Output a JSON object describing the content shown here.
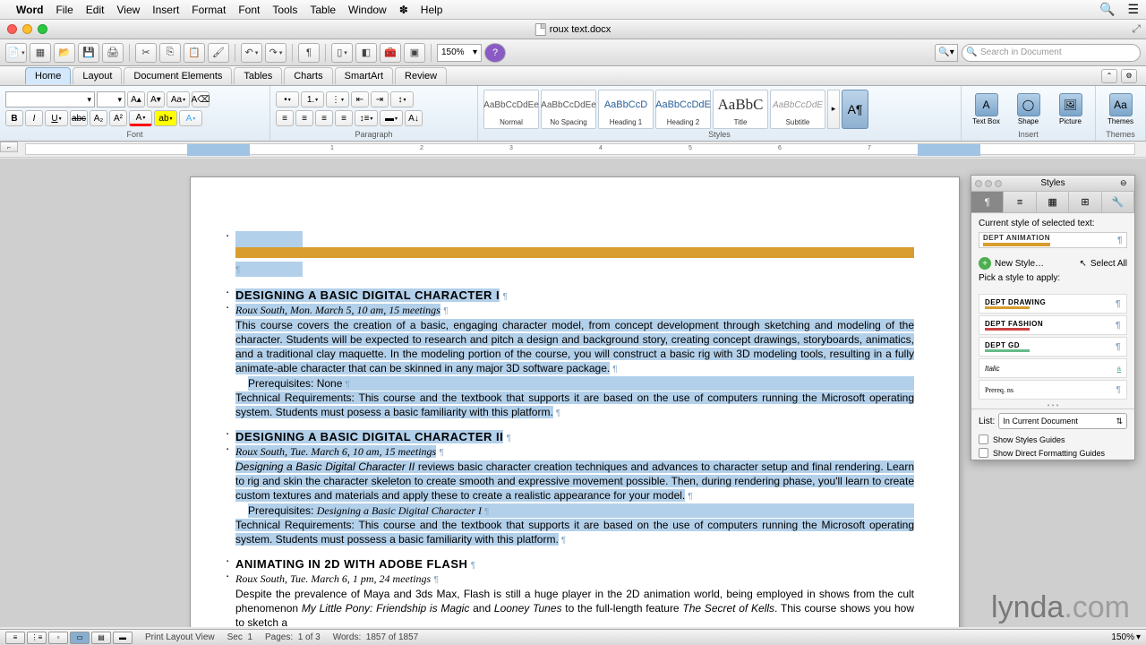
{
  "menubar": {
    "app": "Word",
    "items": [
      "File",
      "Edit",
      "View",
      "Insert",
      "Format",
      "Font",
      "Tools",
      "Table",
      "Window",
      "Help"
    ],
    "script_label": "✽"
  },
  "titlebar": {
    "filename": "roux text.docx"
  },
  "toolbar": {
    "zoom": "150%",
    "search_placeholder": "Search in Document"
  },
  "ribbon": {
    "tabs": [
      "Home",
      "Layout",
      "Document Elements",
      "Tables",
      "Charts",
      "SmartArt",
      "Review"
    ],
    "active": "Home",
    "groups": {
      "font": "Font",
      "paragraph": "Paragraph",
      "styles": "Styles",
      "insert": "Insert",
      "themes": "Themes"
    },
    "style_items": [
      {
        "preview": "AaBbCcDdEe",
        "name": "Normal"
      },
      {
        "preview": "AaBbCcDdEe",
        "name": "No Spacing"
      },
      {
        "preview": "AaBbCcD",
        "name": "Heading 1"
      },
      {
        "preview": "AaBbCcDdE",
        "name": "Heading 2"
      },
      {
        "preview": "AaBbC",
        "name": "Title"
      },
      {
        "preview": "AaBbCcDdE",
        "name": "Subtitle"
      }
    ],
    "inserts": [
      "Text Box",
      "Shape",
      "Picture",
      "Themes"
    ]
  },
  "document": {
    "c1_head": "DESIGNING A BASIC DIGITAL CHARACTER I",
    "c1_loc": "Roux South, Mon. March 5, 10 am, 15 meetings",
    "c1_body": "This course covers the creation of a basic, engaging character model, from concept development through sketching and modeling of the character. Students will be expected to research and pitch a design and background story, creating concept drawings, storyboards, animatics, and a traditional clay maquette. In the modeling portion of the course, you will construct a basic rig with 3D modeling tools, resulting in a fully animate-able character that can be skinned in any major 3D software package.",
    "c1_prereq_lbl": "Prerequisites: ",
    "c1_prereq": "None",
    "c1_tech": "Technical Requirements: This course and the textbook that supports it are based on the use of computers running the Microsoft operating system. Students must posess a basic familiarity with this platform.",
    "c2_head": "DESIGNING A BASIC DIGITAL CHARACTER II",
    "c2_loc": "Roux South, Tue. March 6, 10 am, 15 meetings",
    "c2_body_pre": "Designing a Basic Digital Character II",
    "c2_body": " reviews basic character creation techniques and advances to character setup and final rendering. Learn to rig and skin the character skeleton to create smooth and expressive movement possible. Then, during rendering phase, you'll learn to create custom textures and materials and apply these to create a realistic appearance for your model.",
    "c2_prereq_lbl": "Prerequisites: ",
    "c2_prereq": "Designing a Basic Digital Character I",
    "c2_tech": "Technical Requirements: This course and the textbook that supports it are based on the use of computers running the Microsoft operating system. Students must possess a basic familiarity with this platform.",
    "c3_head": "ANIMATING IN 2D WITH ADOBE FLASH",
    "c3_loc": "Roux South, Tue. March 6, 1 pm, 24 meetings",
    "c3_body1": "Despite the prevalence of Maya and 3ds Max, Flash is still a huge player in the 2D animation world, being employed in shows from the cult phenomenon ",
    "c3_body_i1": "My Little Pony: Friendship is Magic",
    "c3_body2": " and ",
    "c3_body_i2": "Looney Tunes",
    "c3_body3": " to the full-length feature ",
    "c3_body_i3": "The Secret of Kells",
    "c3_body4": ". This course shows you how to sketch a"
  },
  "styles_panel": {
    "title": "Styles",
    "current_label": "Current style of selected text:",
    "current_style": "DEPT ANIMATION",
    "new_style": "New Style…",
    "select_all": "Select All",
    "pick_label": "Pick a style to apply:",
    "entries": [
      {
        "name": "DEPT DRAWING",
        "gold": true,
        "color": "#d89d2e"
      },
      {
        "name": "DEPT FASHION",
        "gold": true,
        "color": "#c44"
      },
      {
        "name": "DEPT GD",
        "gold": true,
        "color": "#6b8"
      },
      {
        "name": "Italic",
        "gold": false
      },
      {
        "name": "Prereq. ns",
        "gold": false
      }
    ],
    "list_label": "List:",
    "list_value": "In Current Document",
    "guide1": "Show Styles Guides",
    "guide2": "Show Direct Formatting Guides"
  },
  "statusbar": {
    "view": "Print Layout View",
    "sec_lbl": "Sec",
    "sec": "1",
    "pages_lbl": "Pages:",
    "pages": "1 of 3",
    "words_lbl": "Words:",
    "words": "1857 of 1857",
    "zoom": "150%"
  },
  "watermark": {
    "pre": "lynda",
    "suf": ".com"
  }
}
